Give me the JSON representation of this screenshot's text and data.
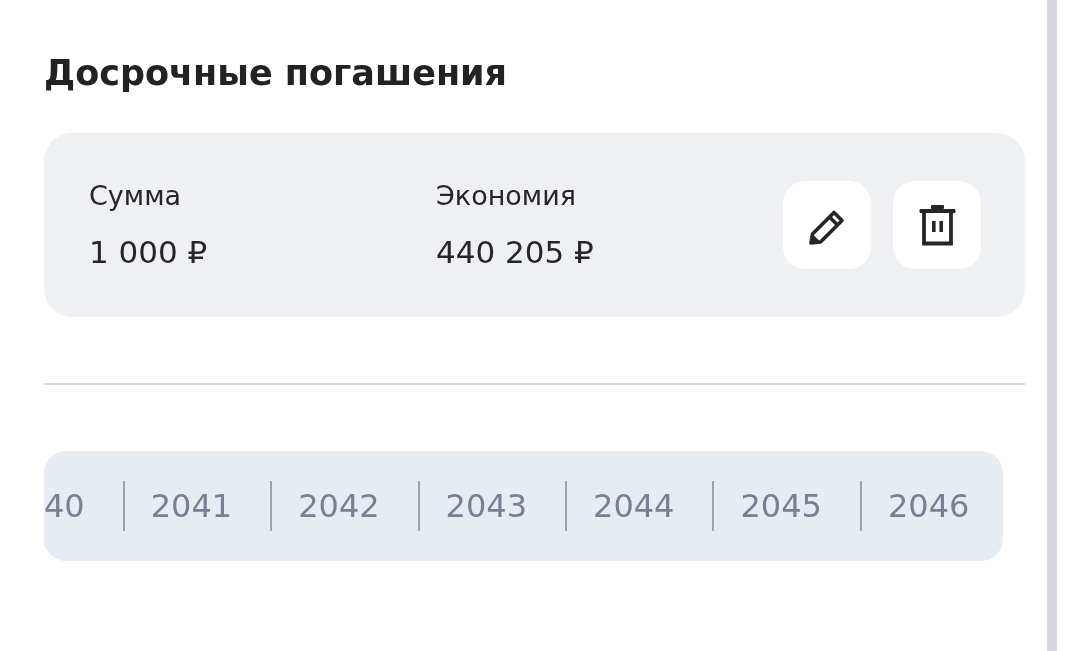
{
  "section": {
    "title": "Досрочные погашения"
  },
  "payments": [
    {
      "fields": [
        {
          "label": "Сумма",
          "value": "1 000 ₽"
        },
        {
          "label": "Экономия",
          "value": "440 205 ₽"
        }
      ],
      "actions": [
        {
          "kind": "edit"
        },
        {
          "kind": "delete"
        }
      ]
    }
  ],
  "years": [
    "40",
    "2041",
    "2042",
    "2043",
    "2044",
    "2045",
    "2046"
  ]
}
